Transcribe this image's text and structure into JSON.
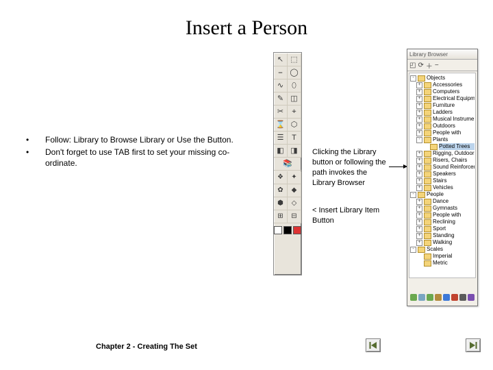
{
  "title": "Insert a Person",
  "bullets": [
    "Follow: Library to Browse Library or Use the Button.",
    "Don't forget to use TAB first to set your missing co-ordinate."
  ],
  "caption_browser": "Clicking the Library button or following the path invokes the Library Browser",
  "caption_insert": "< Insert Library Item Button",
  "footer": "Chapter 2 - Creating The Set",
  "palette": {
    "icons_grid": [
      "↖",
      "⬚",
      "⎯",
      "◯",
      "∿",
      "⬯",
      "✎",
      "◫",
      "✂",
      "⌖",
      "⌛",
      "⬡",
      "☰",
      "T",
      "◧",
      "◨"
    ],
    "single_row": "📚",
    "lower_grid": [
      "❖",
      "✦",
      "✿",
      "◆",
      "⬢",
      "◇",
      "⊞",
      "⊟"
    ],
    "swatches": [
      "#ffffff",
      "#000000",
      "#d33"
    ]
  },
  "library": {
    "title": "Library Browser",
    "toolbar_icons": [
      "◰",
      "⟳",
      "＋",
      "−"
    ],
    "tree": [
      {
        "d": 0,
        "ex": "-",
        "label": "Objects"
      },
      {
        "d": 1,
        "ex": "+",
        "label": "Accessories"
      },
      {
        "d": 1,
        "ex": "+",
        "label": "Computers"
      },
      {
        "d": 1,
        "ex": "+",
        "label": "Electrical Equipment"
      },
      {
        "d": 1,
        "ex": "+",
        "label": "Furniture"
      },
      {
        "d": 1,
        "ex": "+",
        "label": "Ladders"
      },
      {
        "d": 1,
        "ex": "+",
        "label": "Musical Instruments"
      },
      {
        "d": 1,
        "ex": "+",
        "label": "Outdoors"
      },
      {
        "d": 1,
        "ex": "+",
        "label": "People with"
      },
      {
        "d": 1,
        "ex": "-",
        "label": "Plants"
      },
      {
        "d": 2,
        "ex": "",
        "label": "Potted Trees",
        "hl": true
      },
      {
        "d": 1,
        "ex": "+",
        "label": "Rigging, Outdoors"
      },
      {
        "d": 1,
        "ex": "+",
        "label": "Risers, Chairs"
      },
      {
        "d": 1,
        "ex": "+",
        "label": "Sound Reinforcement"
      },
      {
        "d": 1,
        "ex": "+",
        "label": "Speakers"
      },
      {
        "d": 1,
        "ex": "+",
        "label": "Stairs"
      },
      {
        "d": 1,
        "ex": "+",
        "label": "Vehicles"
      },
      {
        "d": 0,
        "ex": "-",
        "label": "People"
      },
      {
        "d": 1,
        "ex": "+",
        "label": "Dance"
      },
      {
        "d": 1,
        "ex": "+",
        "label": "Gymnasts"
      },
      {
        "d": 1,
        "ex": "+",
        "label": "People with"
      },
      {
        "d": 1,
        "ex": "+",
        "label": "Reclining"
      },
      {
        "d": 1,
        "ex": "+",
        "label": "Sport"
      },
      {
        "d": 1,
        "ex": "+",
        "label": "Standing"
      },
      {
        "d": 1,
        "ex": "+",
        "label": "Walking"
      },
      {
        "d": 0,
        "ex": "-",
        "label": "Scales"
      },
      {
        "d": 1,
        "ex": "",
        "label": "Imperial"
      },
      {
        "d": 1,
        "ex": "",
        "label": "Metric"
      }
    ],
    "thumbs": [
      "#6aa84f",
      "#7aa6c2",
      "#6aa84f",
      "#b38b3e",
      "#3c78d8",
      "#c1432e",
      "#5b5b5b",
      "#7a4fb0"
    ]
  }
}
